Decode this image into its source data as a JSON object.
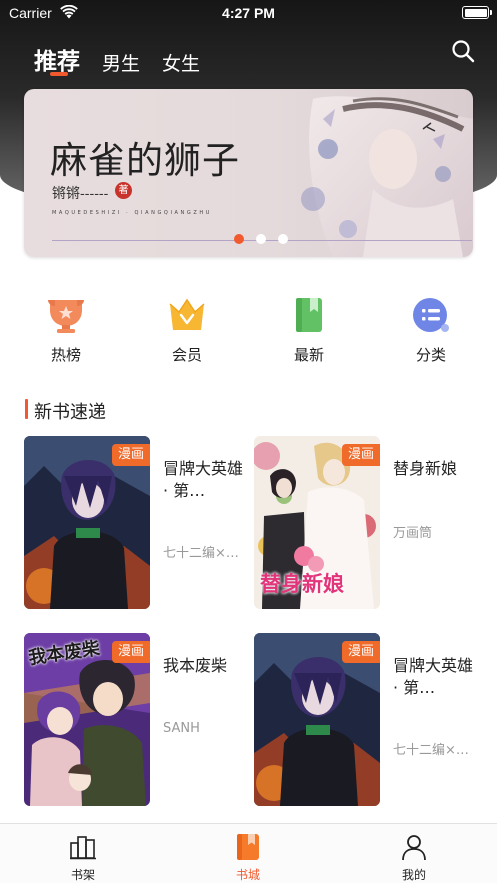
{
  "status_bar": {
    "carrier": "Carrier",
    "time": "4:27 PM"
  },
  "top_tabs": [
    {
      "label": "推荐",
      "active": true
    },
    {
      "label": "男生",
      "active": false
    },
    {
      "label": "女生",
      "active": false
    }
  ],
  "banner": {
    "title": "麻雀的狮子",
    "author": "锵锵------",
    "seal": "著",
    "pinyin": "MAQUEDESHIZI · QIANGQIANGZHU",
    "slide_count": 3,
    "active_slide": 0
  },
  "menu": [
    {
      "label": "热榜",
      "icon": "trophy-icon"
    },
    {
      "label": "会员",
      "icon": "crown-icon"
    },
    {
      "label": "最新",
      "icon": "book-icon"
    },
    {
      "label": "分类",
      "icon": "category-icon"
    }
  ],
  "section": {
    "title": "新书速递"
  },
  "books": [
    {
      "title": "冒牌大英雄 · 第…",
      "author": "七十二编×…",
      "badge": "漫画"
    },
    {
      "title": "替身新娘",
      "author": "万画筒",
      "badge": "漫画",
      "cover_text": "替身新娘"
    },
    {
      "title": "我本废柴",
      "author": "SANH",
      "badge": "漫画",
      "cover_text": "我本废柴"
    },
    {
      "title": "冒牌大英雄 · 第…",
      "author": "七十二编×…",
      "badge": "漫画"
    }
  ],
  "tab_bar": [
    {
      "label": "书架",
      "icon": "bookshelf-icon",
      "active": false
    },
    {
      "label": "书城",
      "icon": "bookstore-icon",
      "active": true
    },
    {
      "label": "我的",
      "icon": "profile-icon",
      "active": false
    }
  ],
  "colors": {
    "accent": "#f05a2e",
    "badge": "#f06a2a",
    "header_dark": "#161616"
  }
}
